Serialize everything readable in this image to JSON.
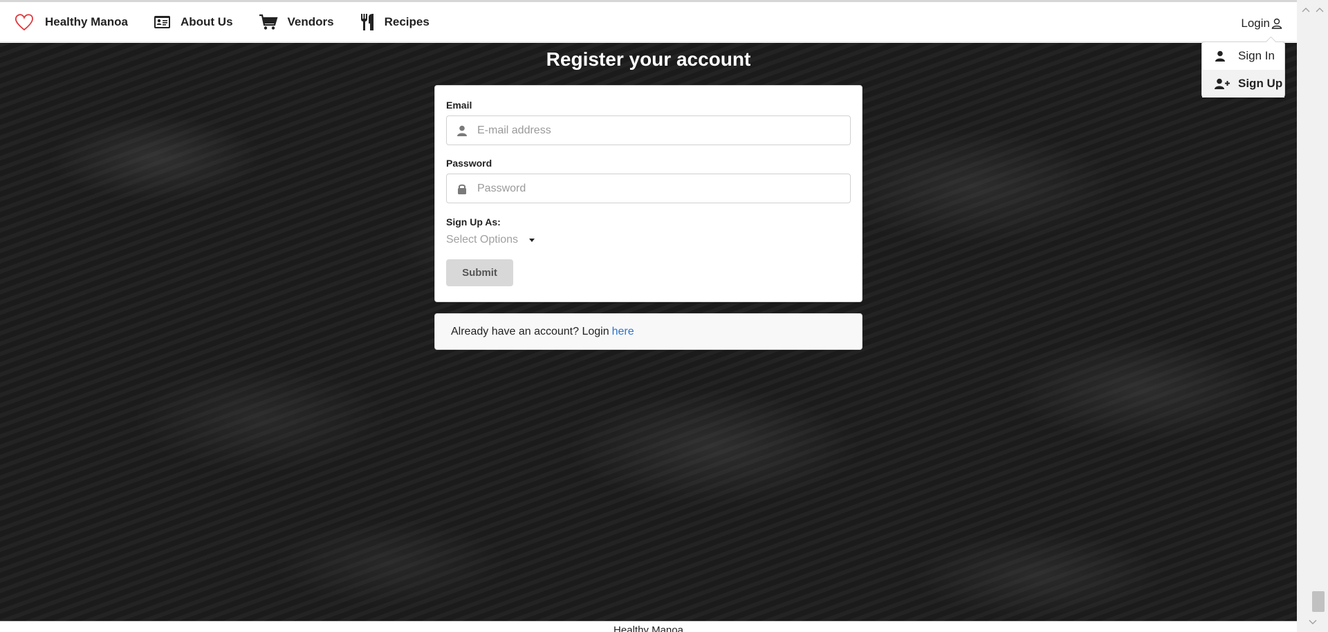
{
  "nav": {
    "brand": "Healthy Manoa",
    "about": "About Us",
    "vendors": "Vendors",
    "recipes": "Recipes",
    "login": "Login"
  },
  "dropdown": {
    "sign_in": "Sign In",
    "sign_up": "Sign Up"
  },
  "page": {
    "title": "Register your account"
  },
  "form": {
    "email_label": "Email",
    "email_placeholder": "E-mail address",
    "password_label": "Password",
    "password_placeholder": "Password",
    "signup_as_label": "Sign Up As:",
    "select_placeholder": "Select Options",
    "submit_label": "Submit"
  },
  "message": {
    "text": "Already have an account? Login",
    "link": "here"
  },
  "footer": {
    "text": "Healthy Manoa"
  },
  "colors": {
    "brand_heart": "#e0393e",
    "link": "#2b73c9",
    "background": "#1c1c1c"
  },
  "icons": {
    "brand": "heart-icon",
    "about": "id-card-icon",
    "vendors": "cart-icon",
    "recipes": "utensils-icon",
    "login": "user-outline-icon",
    "sign_in": "user-icon",
    "sign_up": "user-plus-icon",
    "email": "user-icon",
    "password": "lock-icon"
  }
}
